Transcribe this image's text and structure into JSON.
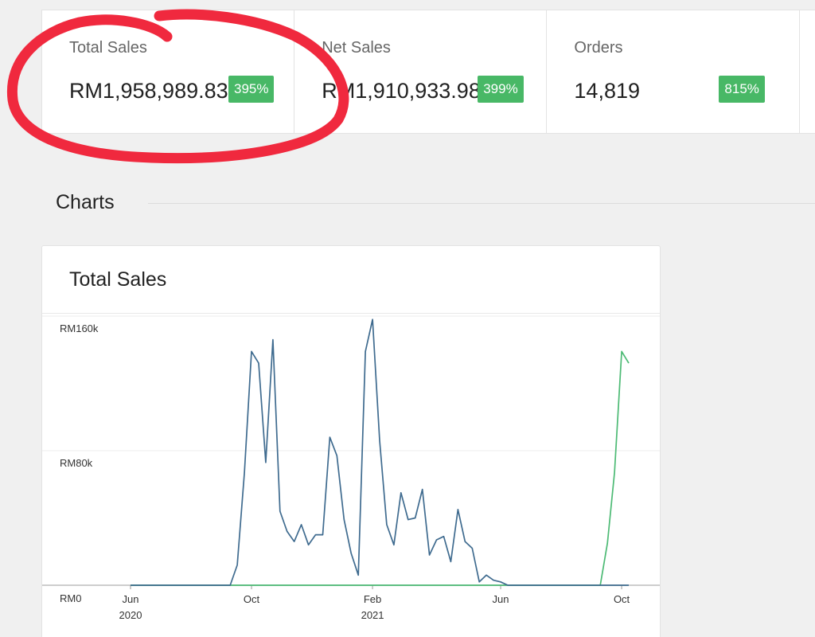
{
  "stats": [
    {
      "label": "Total Sales",
      "value": "RM1,958,989.83",
      "badge": "395%"
    },
    {
      "label": "Net Sales",
      "value": "RM1,910,933.98",
      "badge": "399%"
    },
    {
      "label": "Orders",
      "value": "14,819",
      "badge": "815%"
    }
  ],
  "colors": {
    "badge": "#48b866",
    "series_current": "#3f6b8f",
    "series_previous": "#4cba74",
    "annotation": "#f0293e"
  },
  "section_title": "Charts",
  "chart_data": {
    "type": "line",
    "title": "Total Sales",
    "xlabel": "",
    "ylabel": "",
    "y_ticks": [
      "RM0",
      "RM80k",
      "RM160k"
    ],
    "y_tick_values": [
      0,
      80000,
      160000
    ],
    "ylim": [
      0,
      160000
    ],
    "x_ticks": [
      {
        "label": "Jun",
        "sub": "2020",
        "index": 0
      },
      {
        "label": "Oct",
        "sub": "",
        "index": 17
      },
      {
        "label": "Feb",
        "sub": "2021",
        "index": 34
      },
      {
        "label": "Jun",
        "sub": "",
        "index": 52
      },
      {
        "label": "Oct",
        "sub": "",
        "index": 69
      }
    ],
    "grid": true,
    "series": [
      {
        "values": [
          0,
          0,
          0,
          0,
          0,
          0,
          0,
          0,
          0,
          0,
          0,
          0,
          0,
          0,
          0,
          12000,
          67000,
          139000,
          132000,
          73000,
          146000,
          44000,
          32000,
          26000,
          36000,
          24000,
          30000,
          30000,
          88000,
          77000,
          39000,
          19000,
          6000,
          139000,
          158000,
          86000,
          36000,
          24000,
          55000,
          39000,
          40000,
          57000,
          18000,
          27000,
          29000,
          14000,
          45000,
          26000,
          22000,
          2000,
          6000,
          3000,
          2000,
          0,
          0,
          0,
          0,
          0,
          0,
          0,
          0,
          0,
          0,
          0,
          0,
          0,
          0,
          0,
          0,
          0,
          0
        ],
        "color": "#3f6b8f"
      },
      {
        "values": [
          0,
          0,
          0,
          0,
          0,
          0,
          0,
          0,
          0,
          0,
          0,
          0,
          0,
          0,
          0,
          0,
          0,
          0,
          0,
          0,
          0,
          0,
          0,
          0,
          0,
          0,
          0,
          0,
          0,
          0,
          0,
          0,
          0,
          0,
          0,
          0,
          0,
          0,
          0,
          0,
          0,
          0,
          0,
          0,
          0,
          0,
          0,
          0,
          0,
          0,
          0,
          0,
          0,
          0,
          0,
          0,
          0,
          0,
          0,
          0,
          0,
          0,
          0,
          0,
          0,
          0,
          0,
          25000,
          67000,
          139000,
          132000
        ],
        "color": "#4cba74"
      }
    ]
  }
}
